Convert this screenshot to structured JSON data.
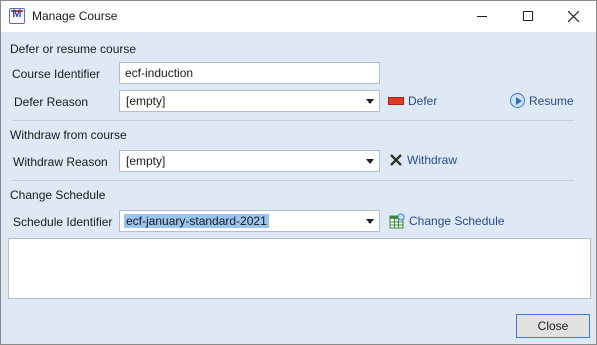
{
  "window": {
    "title": "Manage Course",
    "app_icon_letter": "M",
    "controls": [
      "minimize-icon",
      "maximize-icon",
      "close-icon"
    ]
  },
  "defer_section": {
    "title": "Defer or resume course",
    "course_identifier_label": "Course Identifier",
    "course_identifier_value": "ecf-induction",
    "defer_reason_label": "Defer Reason",
    "defer_reason_value": "[empty]",
    "defer_link": "Defer",
    "resume_link": "Resume"
  },
  "withdraw_section": {
    "title": "Withdraw from course",
    "withdraw_reason_label": "Withdraw Reason",
    "withdraw_reason_value": "[empty]",
    "withdraw_link": "Withdraw"
  },
  "schedule_section": {
    "title": "Change Schedule",
    "schedule_identifier_label": "Schedule Identifier",
    "schedule_identifier_value": "ecf-january-standard-2021",
    "change_schedule_link": "Change Schedule"
  },
  "footer": {
    "close_label": "Close"
  },
  "colors": {
    "dialog_bg": "#dfe8f5",
    "link": "#2a4a92",
    "selection": "#99c4f0",
    "defer_icon": "#e23a22"
  }
}
